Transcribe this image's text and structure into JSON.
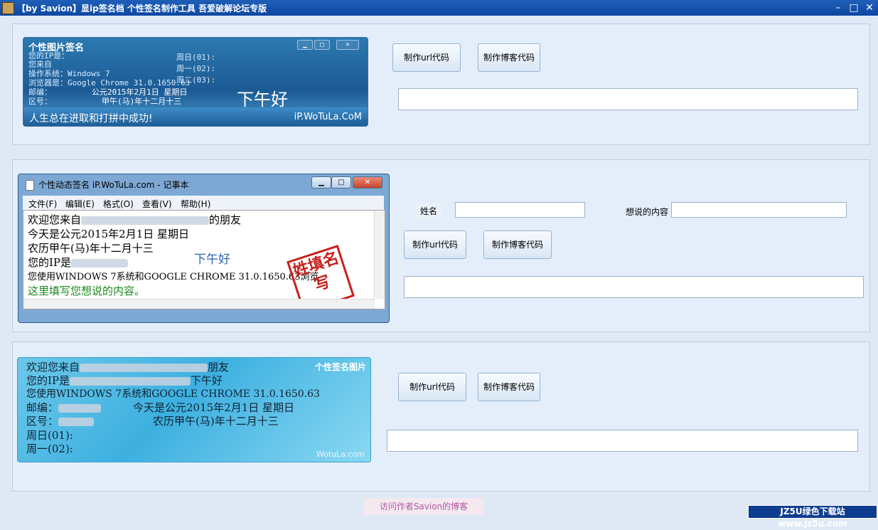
{
  "window": {
    "title": "【by Savion】显ip签名档 个性签名制作工具 吾爱破解论坛专版",
    "minimize": "–",
    "maximize": "□",
    "close": "✕"
  },
  "buttons": {
    "make_url": "制作url代码",
    "make_blog": "制作博客代码"
  },
  "sig1": {
    "title": "个性图片签名",
    "rows": [
      "您的IP是：",
      "您来自",
      "操作系统：Windows 7",
      "浏览器是：Google Chrome 31.0.1650.63",
      "邮编：",
      "区号："
    ],
    "week": [
      "周日(01):",
      "周一(02):",
      "周二(03):"
    ],
    "date": "公元2015年2月1日 星期日",
    "lunar": "甲午(马)年十二月十三",
    "greeting": "下午好",
    "motto": "人生总在进取和打拼中成功!",
    "site": "iP.WoTuLa.CoM"
  },
  "notepad": {
    "caption": "个性动态签名 iP.WoTuLa.com - 记事本",
    "menu": [
      "文件(F)",
      "编辑(E)",
      "格式(O)",
      "查看(V)",
      "帮助(H)"
    ],
    "lines": [
      "欢迎您来自",
      "今天是公元2015年2月1日 星期日",
      "农历甲午(马)年十二月十三",
      "您的IP是",
      "您使用WINDOWS 7系统和GOOGLE CHROME 31.0.1650.63浏览",
      "这里填写您想说的内容。"
    ],
    "friend": "的朋友",
    "greeting": "下午好",
    "stamp": "姓填名写"
  },
  "form2": {
    "name_label": "姓名",
    "say_label": "想说的内容"
  },
  "sig3": {
    "badge": "个性签名图片",
    "lines": [
      "欢迎您来自",
      "您的IP是",
      "您使用WINDOWS 7系统和GOOGLE CHROME 31.0.1650.63",
      "邮编：",
      "区号：",
      "周日(01):",
      "周一(02):"
    ],
    "friend": "朋友",
    "greeting": "下午好",
    "date": "今天是公元2015年2月1日 星期日",
    "lunar": "农历甲午(马)年十二月十三",
    "watermark": "WotuLa.com"
  },
  "author_link": "访问作者Savion的博客",
  "corner_badge": "JZ5U绿色下载站www.jz5u.com"
}
